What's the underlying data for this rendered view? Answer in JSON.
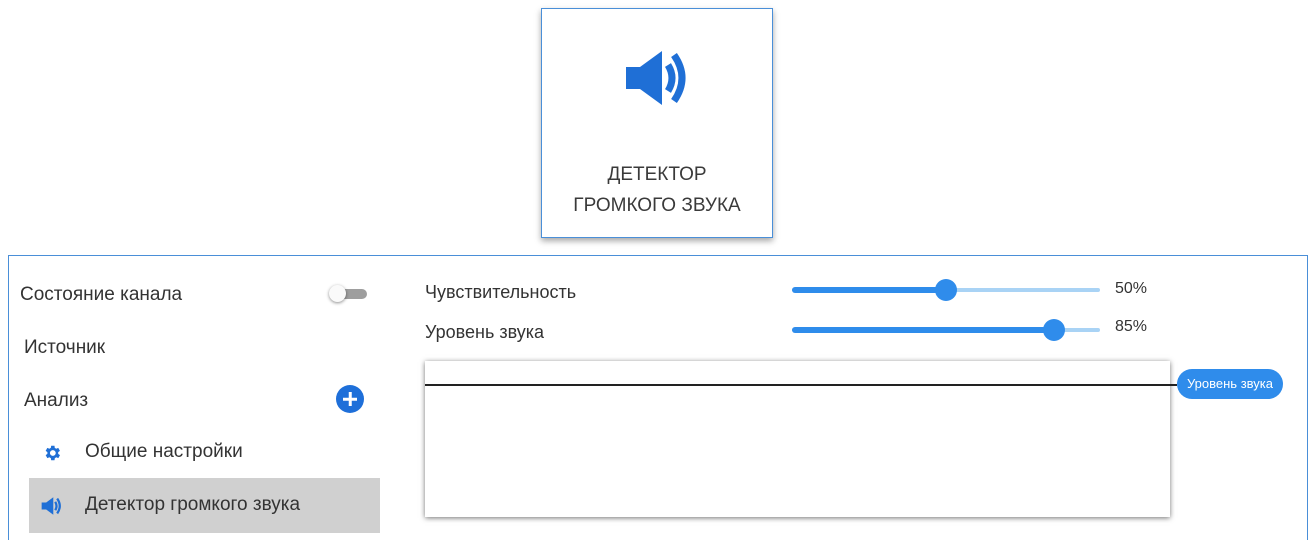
{
  "tile": {
    "icon": "speaker-icon",
    "title_line1": "ДЕТЕКТОР",
    "title_line2": "ГРОМКОГО ЗВУКА"
  },
  "sidebar": {
    "channel_state_label": "Состояние канала",
    "channel_state_on": false,
    "source_label": "Источник",
    "analysis_label": "Анализ",
    "items": [
      {
        "label": "Общие настройки",
        "icon": "gear-icon",
        "selected": false
      },
      {
        "label": "Детектор громкого звука",
        "icon": "speaker-icon",
        "selected": true
      }
    ]
  },
  "settings": {
    "sensitivity": {
      "label": "Чувствительность",
      "value": 50,
      "value_text": "50%"
    },
    "sound_level": {
      "label": "Уровень звука",
      "value": 85,
      "value_text": "85%"
    }
  },
  "graph": {
    "badge_label": "Уровень звука"
  },
  "colors": {
    "accent": "#2f8ceb",
    "border": "#4a8fd8",
    "selected_bg": "#d0d0d0"
  }
}
